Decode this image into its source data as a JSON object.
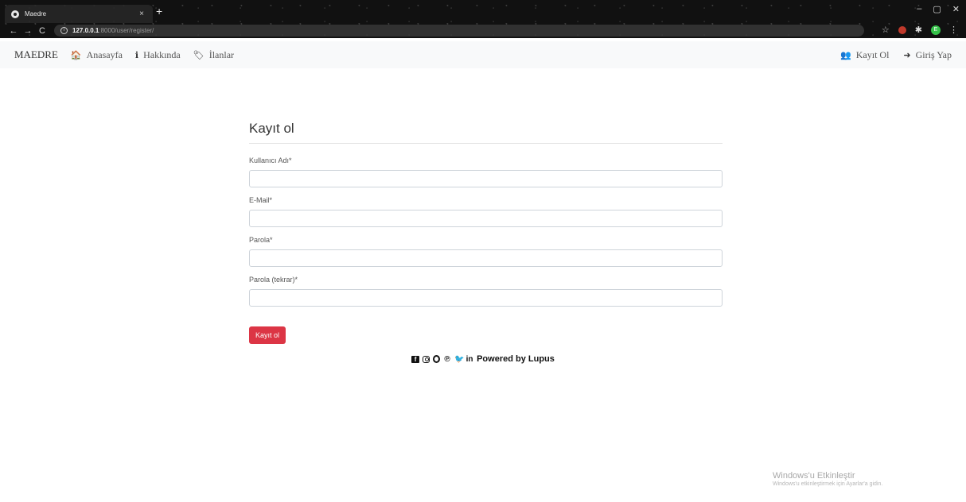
{
  "browser": {
    "tab_title": "Maedre",
    "tab_close": "×",
    "new_tab": "+",
    "url_host": "127.0.0.1",
    "url_rest": ":8000/user/register/",
    "profile_initial": "E"
  },
  "icons": {
    "back": "←",
    "forward": "→",
    "reload": "C",
    "info": "i",
    "star": "☆",
    "puzzle": "✱",
    "menu": "⋮",
    "minimize": "–",
    "restore": "▢",
    "close": "✕",
    "home": "🏠",
    "info_nav": "ℹ",
    "tag": "🏷",
    "user_plus": "👥",
    "sign_in": "➜",
    "facebook": "f",
    "pinterest": "℗",
    "twitter": "🐦",
    "linkedin": "in"
  },
  "navbar": {
    "brand": "MAEDRE",
    "links": [
      {
        "label": "Anasayfa"
      },
      {
        "label": "Hakkında"
      },
      {
        "label": "İlanlar"
      }
    ],
    "register": "Kayıt Ol",
    "login": "Giriş Yap"
  },
  "form": {
    "title": "Kayıt ol",
    "fields": [
      {
        "label": "Kullanıcı Adı*",
        "value": ""
      },
      {
        "label": "E-Mail*",
        "value": ""
      },
      {
        "label": "Parola*",
        "value": ""
      },
      {
        "label": "Parola (tekrar)*",
        "value": ""
      }
    ],
    "submit_label": "Kayıt ol"
  },
  "footer": {
    "text": "Powered by Lupus"
  },
  "watermark": {
    "title": "Windows'u Etkinleştir",
    "subtitle": "Windows'u etkinleştirmek için Ayarlar'a gidin."
  },
  "colors": {
    "accent": "#dc3545",
    "navbar_bg": "#f8f9fa"
  }
}
